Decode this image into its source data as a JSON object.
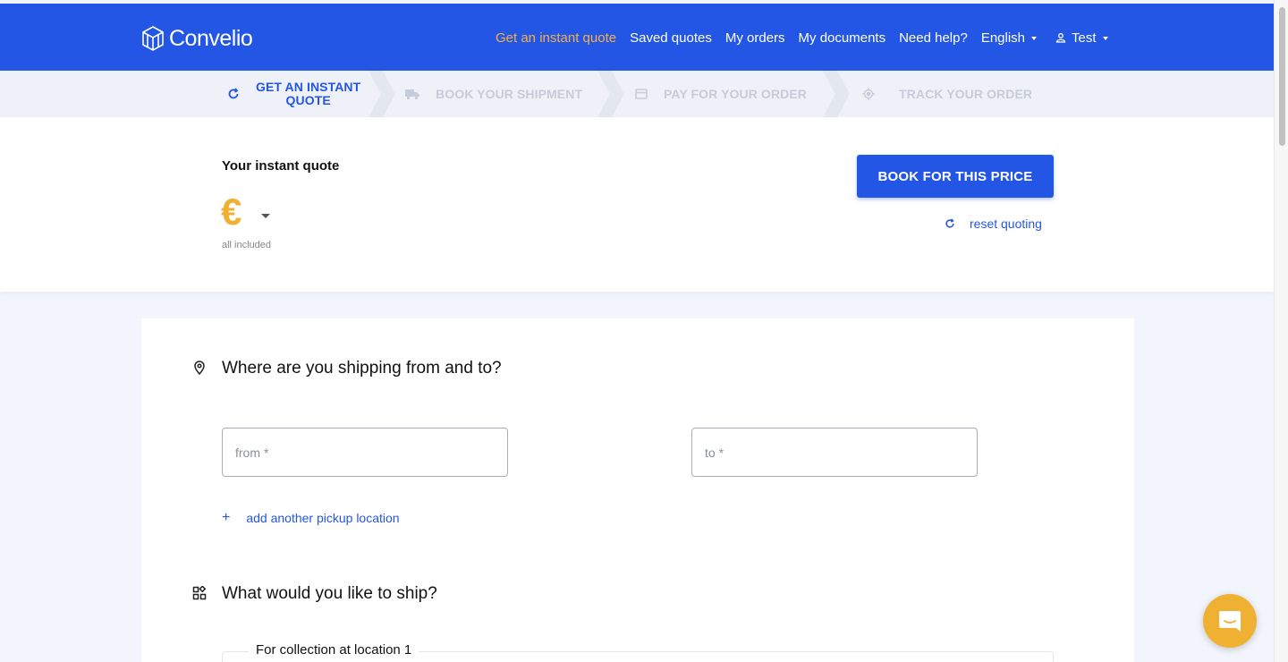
{
  "brand": {
    "name": "Convelio"
  },
  "nav": {
    "items": [
      {
        "label": "Get an instant quote",
        "active": true
      },
      {
        "label": "Saved quotes"
      },
      {
        "label": "My orders"
      },
      {
        "label": "My documents"
      },
      {
        "label": "Need help?"
      }
    ],
    "language": "English",
    "user": "Test"
  },
  "steps": [
    {
      "line1": "GET AN INSTANT",
      "line2": "QUOTE",
      "icon": "refresh-icon",
      "active": true
    },
    {
      "label": "BOOK YOUR SHIPMENT",
      "icon": "truck-icon"
    },
    {
      "label": "PAY FOR YOUR ORDER",
      "icon": "card-icon"
    },
    {
      "label": "TRACK YOUR ORDER",
      "icon": "target-icon"
    }
  ],
  "quote": {
    "title": "Your instant quote",
    "currency_symbol": "€",
    "subtext": "all included",
    "book_label": "BOOK FOR THIS PRICE",
    "reset_label": "reset quoting"
  },
  "form": {
    "route_title": "Where are you shipping from and to?",
    "from_placeholder": "from *",
    "to_placeholder": "to *",
    "add_location": "add another pickup location",
    "ship_title": "What would you like to ship?",
    "collection_legend": "For collection at location 1"
  },
  "colors": {
    "primary": "#2456e6",
    "accent": "#f0b133"
  }
}
